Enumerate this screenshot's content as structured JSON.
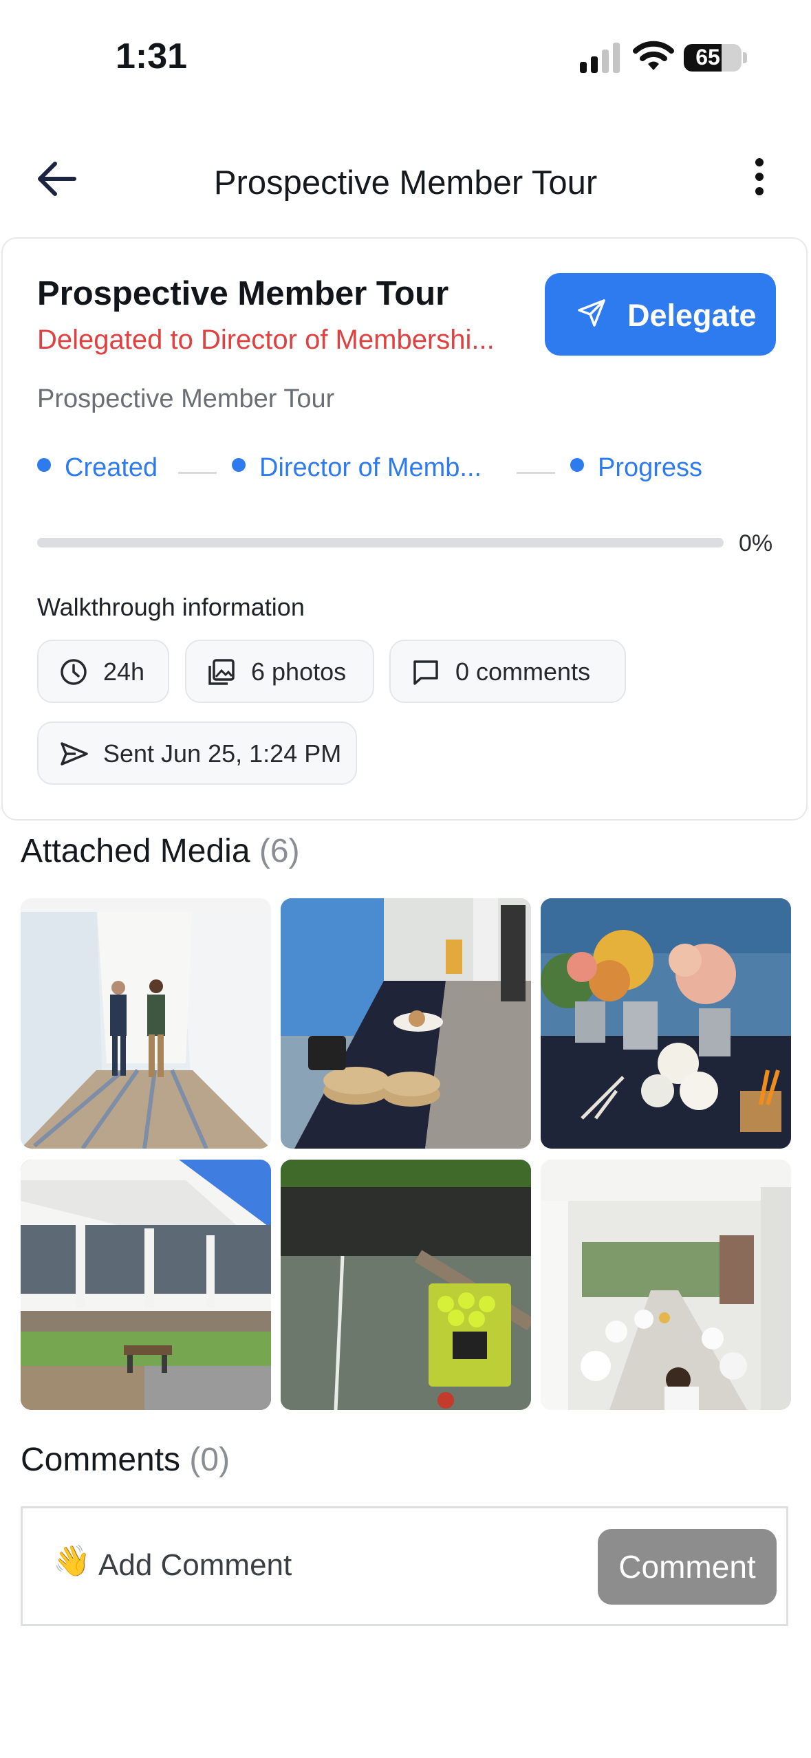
{
  "status_bar": {
    "time": "1:31",
    "battery_level": "65"
  },
  "header": {
    "title": "Prospective Member Tour",
    "back_icon": "arrow-left-icon",
    "menu_icon": "more-vertical-icon"
  },
  "task": {
    "title": "Prospective Member Tour",
    "subtitle": "Delegated to Director  of Membershi...",
    "description": "Prospective Member Tour",
    "delegate_button": {
      "label": "Delegate",
      "icon": "send-icon"
    },
    "steps": [
      {
        "label": "Created"
      },
      {
        "label": "Director  of Memb..."
      },
      {
        "label": "Progress"
      }
    ],
    "progress": {
      "value": 0,
      "label": "0%"
    }
  },
  "walkthrough": {
    "label": "Walkthrough information",
    "chips": [
      {
        "icon": "clock-icon",
        "text": "24h"
      },
      {
        "icon": "photos-icon",
        "text": "6 photos"
      },
      {
        "icon": "comment-icon",
        "text": "0 comments"
      },
      {
        "icon": "send-icon",
        "text": "Sent Jun 25, 1:24 PM"
      }
    ]
  },
  "media": {
    "title": "Attached Media",
    "count": "(6)"
  },
  "comments": {
    "title": "Comments",
    "count": "(0)",
    "emoji": "👋",
    "placeholder": "Add Comment",
    "button_label": "Comment"
  },
  "colors": {
    "accent": "#2e7bf0",
    "danger": "#e0403f",
    "button_disabled": "#8d8d8d"
  }
}
